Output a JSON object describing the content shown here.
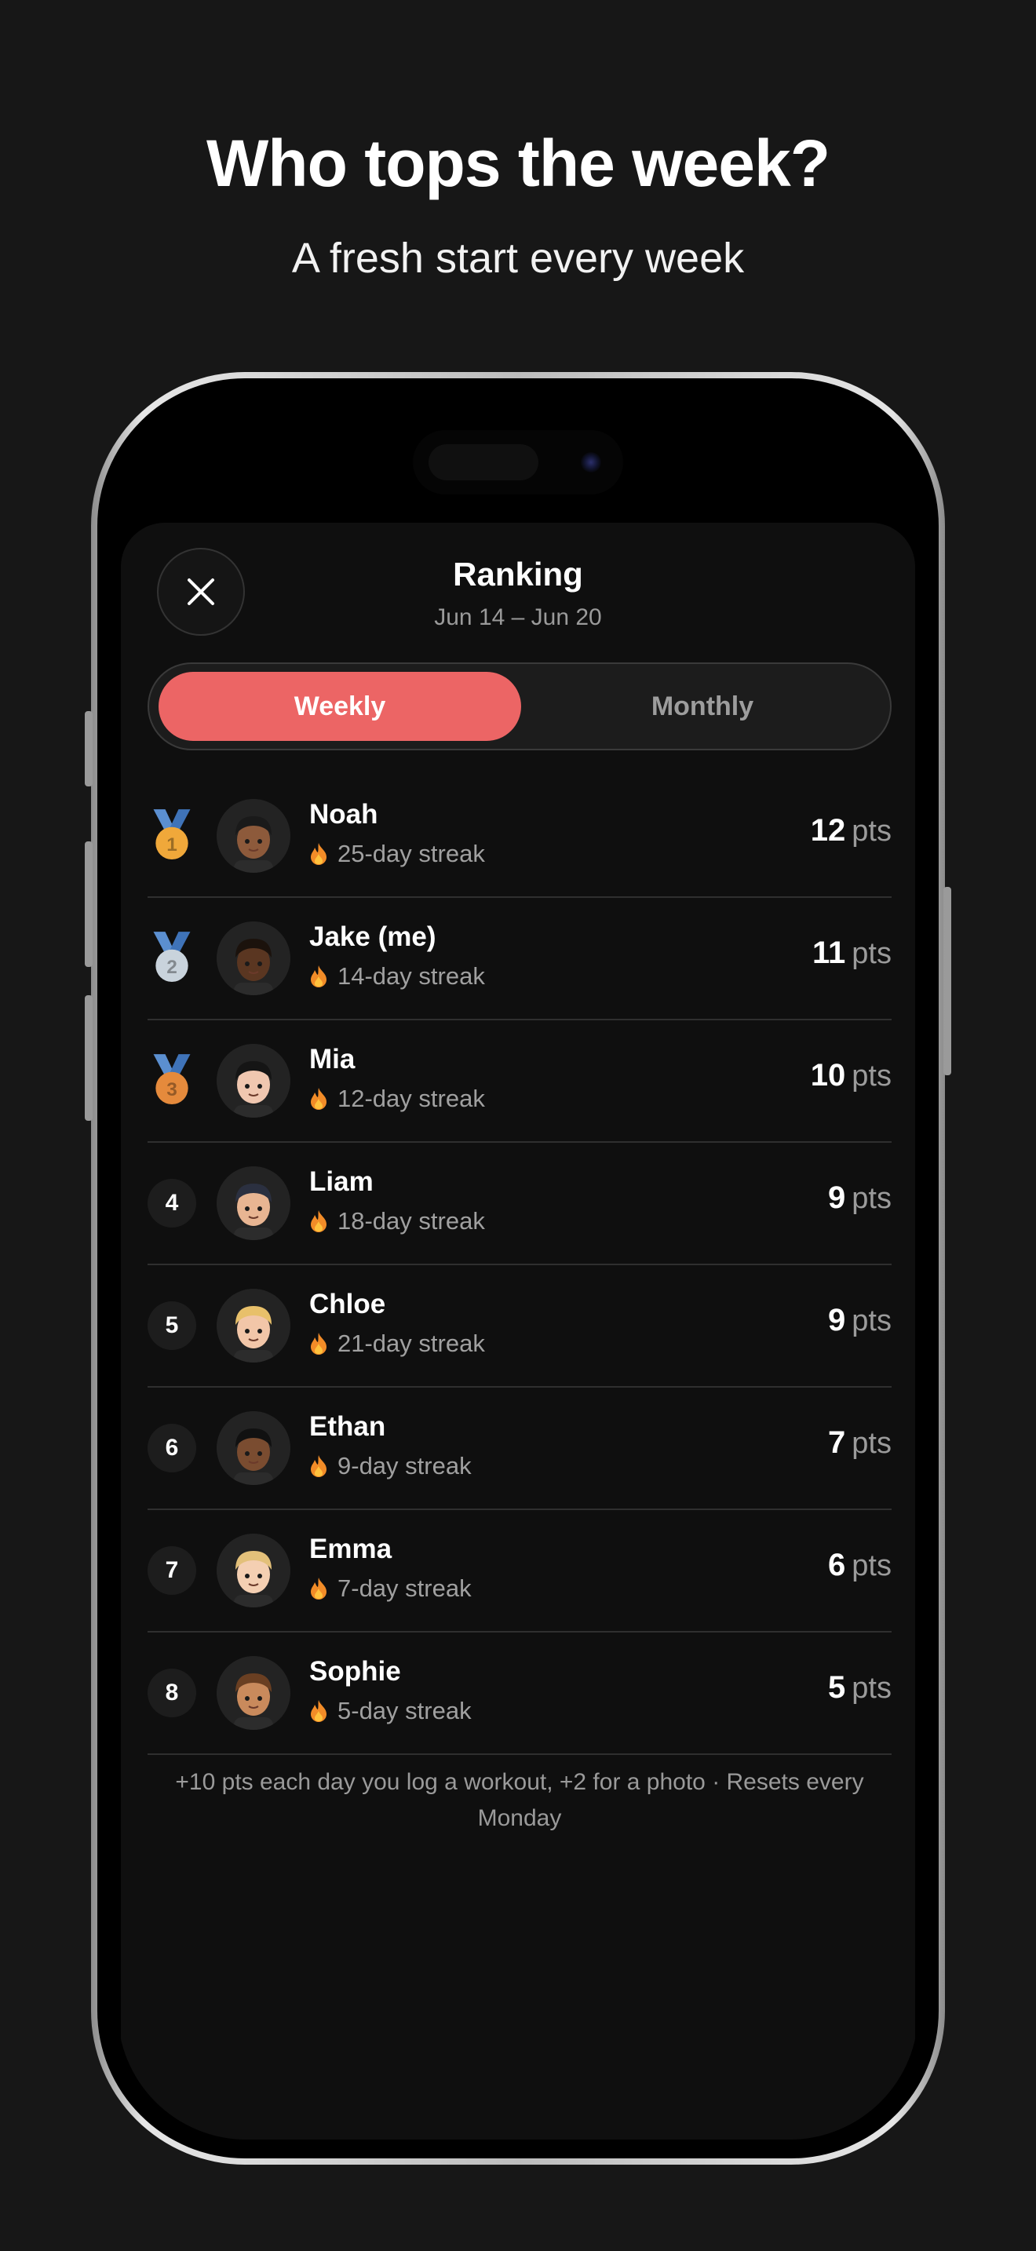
{
  "header": {
    "headline": "Who tops the week?",
    "subline": "A fresh start every week"
  },
  "sheet": {
    "title": "Ranking",
    "date_range": "Jun 14 – Jun 20",
    "tabs": {
      "weekly": "Weekly",
      "monthly": "Monthly",
      "selected": "Weekly"
    },
    "footnote": "+10 pts each day you log a workout, +2 for a photo · Resets every Monday"
  },
  "points_suffix": "pts",
  "colors": {
    "accent": "#ec6565",
    "gold": "#f0a83a",
    "silver": "#c9d3dc",
    "bronze": "#e58a3c",
    "ribbon": "#5b8fd0"
  },
  "ranking": [
    {
      "rank": "1",
      "medal": "gold-medal-icon",
      "name": "Noah",
      "streak": "25-day streak",
      "points": "12",
      "avatar": "avatar-noah",
      "skin": "#8d5a3b",
      "hair": "#1a1a1a"
    },
    {
      "rank": "2",
      "medal": "silver-medal-icon",
      "name": "Jake (me)",
      "streak": "14-day streak",
      "points": "11",
      "avatar": "avatar-jake",
      "skin": "#5a3621",
      "hair": "#1b120c"
    },
    {
      "rank": "3",
      "medal": "bronze-medal-icon",
      "name": "Mia",
      "streak": "12-day streak",
      "points": "10",
      "avatar": "avatar-mia",
      "skin": "#f0c7b0",
      "hair": "#151515"
    },
    {
      "rank": "4",
      "name": "Liam",
      "streak": "18-day streak",
      "points": "9",
      "avatar": "avatar-liam",
      "skin": "#e8b592",
      "hair": "#2b3040"
    },
    {
      "rank": "5",
      "name": "Chloe",
      "streak": "21-day streak",
      "points": "9",
      "avatar": "avatar-chloe",
      "skin": "#f2c6a8",
      "hair": "#e8c06a"
    },
    {
      "rank": "6",
      "name": "Ethan",
      "streak": "9-day streak",
      "points": "7",
      "avatar": "avatar-ethan",
      "skin": "#7a4c30",
      "hair": "#111111"
    },
    {
      "rank": "7",
      "name": "Emma",
      "streak": "7-day streak",
      "points": "6",
      "avatar": "avatar-emma",
      "skin": "#f4cfb2",
      "hair": "#e3c07a"
    },
    {
      "rank": "8",
      "name": "Sophie",
      "streak": "5-day streak",
      "points": "5",
      "avatar": "avatar-sophie",
      "skin": "#c98a5c",
      "hair": "#6a3f22"
    }
  ]
}
